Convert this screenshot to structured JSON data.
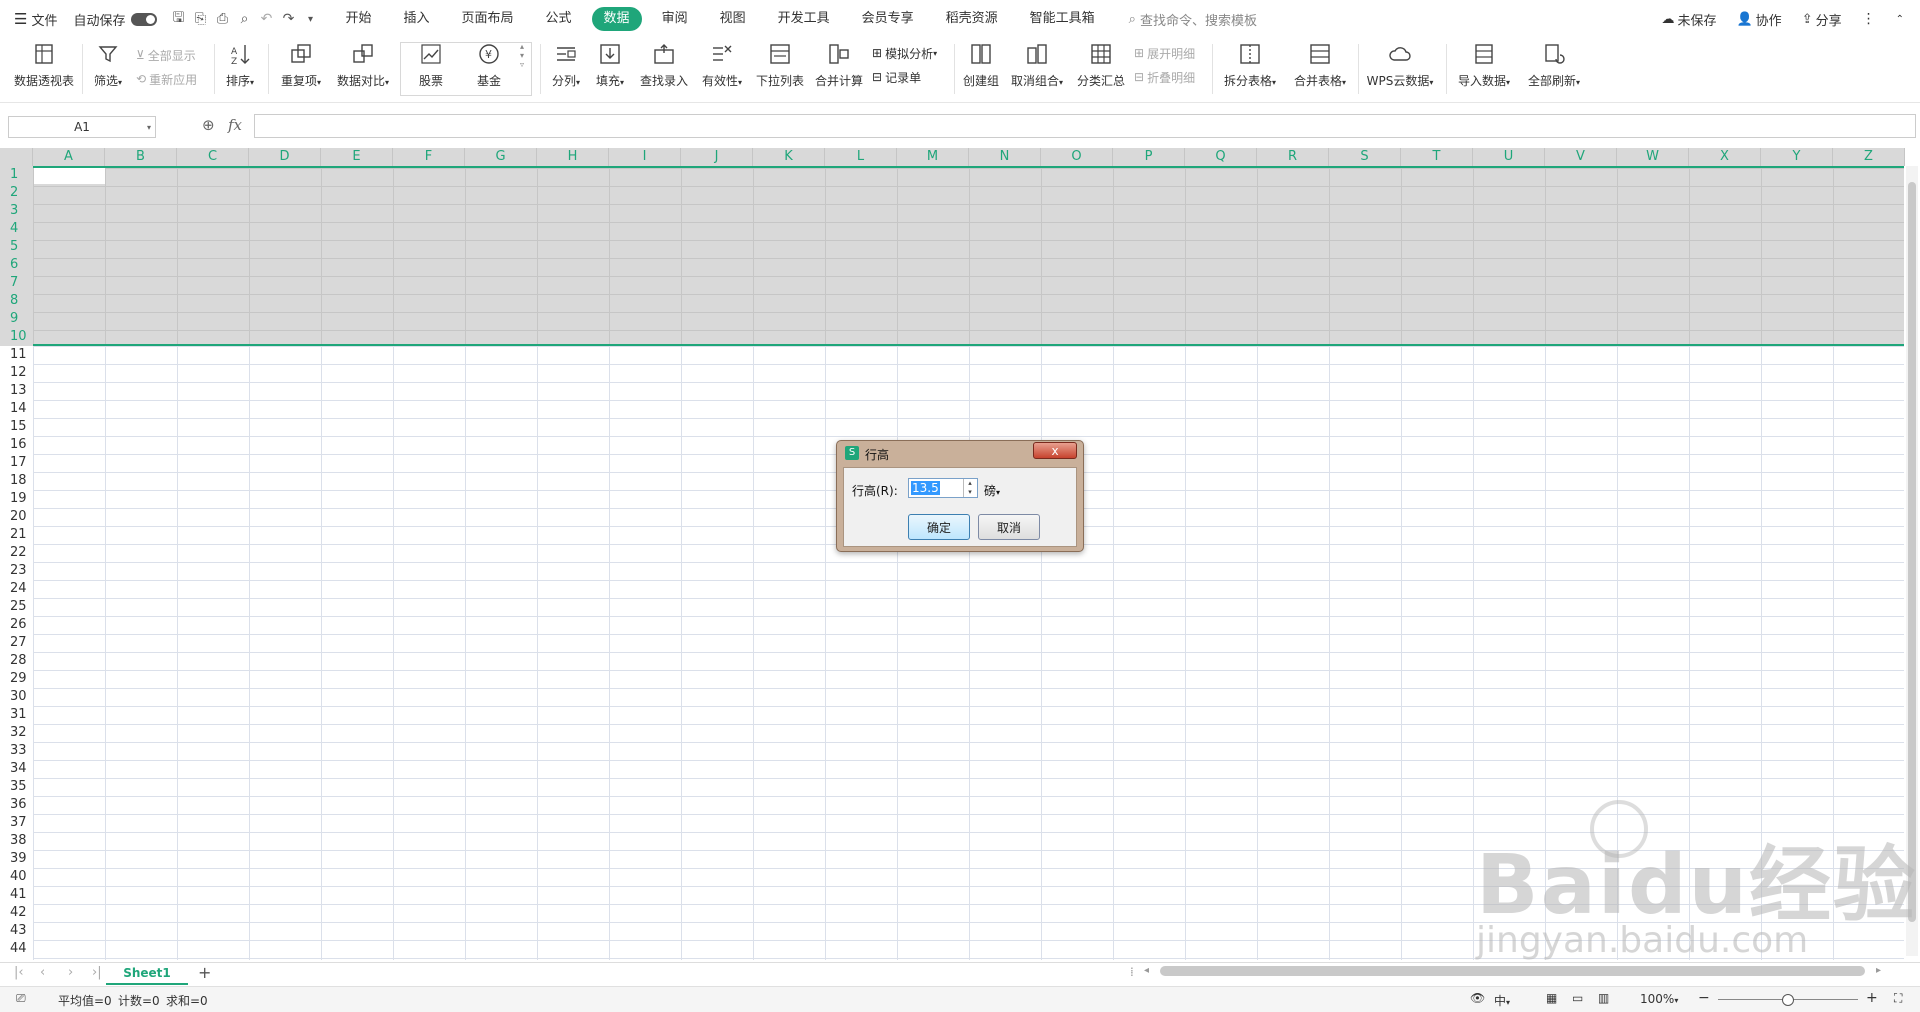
{
  "topbar": {
    "file": "文件",
    "autosave": "自动保存",
    "tabs": [
      "开始",
      "插入",
      "页面布局",
      "公式",
      "数据",
      "审阅",
      "视图",
      "开发工具",
      "会员专享",
      "稻壳资源",
      "智能工具箱"
    ],
    "active_tab": "数据",
    "search_placeholder": "查找命令、搜索模板",
    "unsaved": "未保存",
    "collab": "协作",
    "share": "分享"
  },
  "ribbon": {
    "pivot": "数据透视表",
    "filter": "筛选",
    "show_all": "全部显示",
    "reapply": "重新应用",
    "sort": "排序",
    "duplicates": "重复项",
    "compare": "数据对比",
    "stock": "股票",
    "fund": "基金",
    "split": "分列",
    "fill": "填充",
    "lookup": "查找录入",
    "validity": "有效性",
    "dropdown": "下拉列表",
    "consolidate": "合并计算",
    "simulate": "模拟分析",
    "record": "记录单",
    "create_group": "创建组",
    "ungroup": "取消组合",
    "subtotal": "分类汇总",
    "expand": "展开明细",
    "collapse": "折叠明细",
    "split_table": "拆分表格",
    "merge_table": "合并表格",
    "wps_cloud": "WPS云数据",
    "import": "导入数据",
    "refresh_all": "全部刷新"
  },
  "formula_bar": {
    "cell_ref": "A1",
    "fx": "fx",
    "value": ""
  },
  "grid": {
    "columns": [
      "A",
      "B",
      "C",
      "D",
      "E",
      "F",
      "G",
      "H",
      "I",
      "J",
      "K",
      "L",
      "M",
      "N",
      "O",
      "P",
      "Q",
      "R",
      "S",
      "T",
      "U",
      "V",
      "W",
      "X",
      "Y",
      "Z"
    ],
    "rows": [
      "1",
      "2",
      "3",
      "4",
      "5",
      "6",
      "7",
      "8",
      "9",
      "10",
      "11",
      "12",
      "13",
      "14",
      "15",
      "16",
      "17",
      "18",
      "19",
      "20",
      "21",
      "22",
      "23",
      "24",
      "25",
      "26",
      "27",
      "28",
      "29",
      "30",
      "31",
      "32",
      "33",
      "34",
      "35",
      "36",
      "37",
      "38",
      "39",
      "40",
      "41",
      "42",
      "43",
      "44"
    ],
    "selected_rows": "1-10"
  },
  "sheets": {
    "tabs": [
      "Sheet1"
    ],
    "add": "+"
  },
  "status": {
    "average": "平均值=0",
    "count": "计数=0",
    "sum": "求和=0",
    "input_mode": "中",
    "zoom": "100%"
  },
  "dialog": {
    "title": "行高",
    "icon": "S",
    "label": "行高(R):",
    "value": "13.5",
    "unit": "磅",
    "ok": "确定",
    "cancel": "取消",
    "close": "x"
  },
  "watermark": {
    "brand": "Baidu经验",
    "url": "jingyan.baidu.com"
  },
  "colors": {
    "accent": "#1fa67a",
    "selection": "#d9d9d9"
  }
}
